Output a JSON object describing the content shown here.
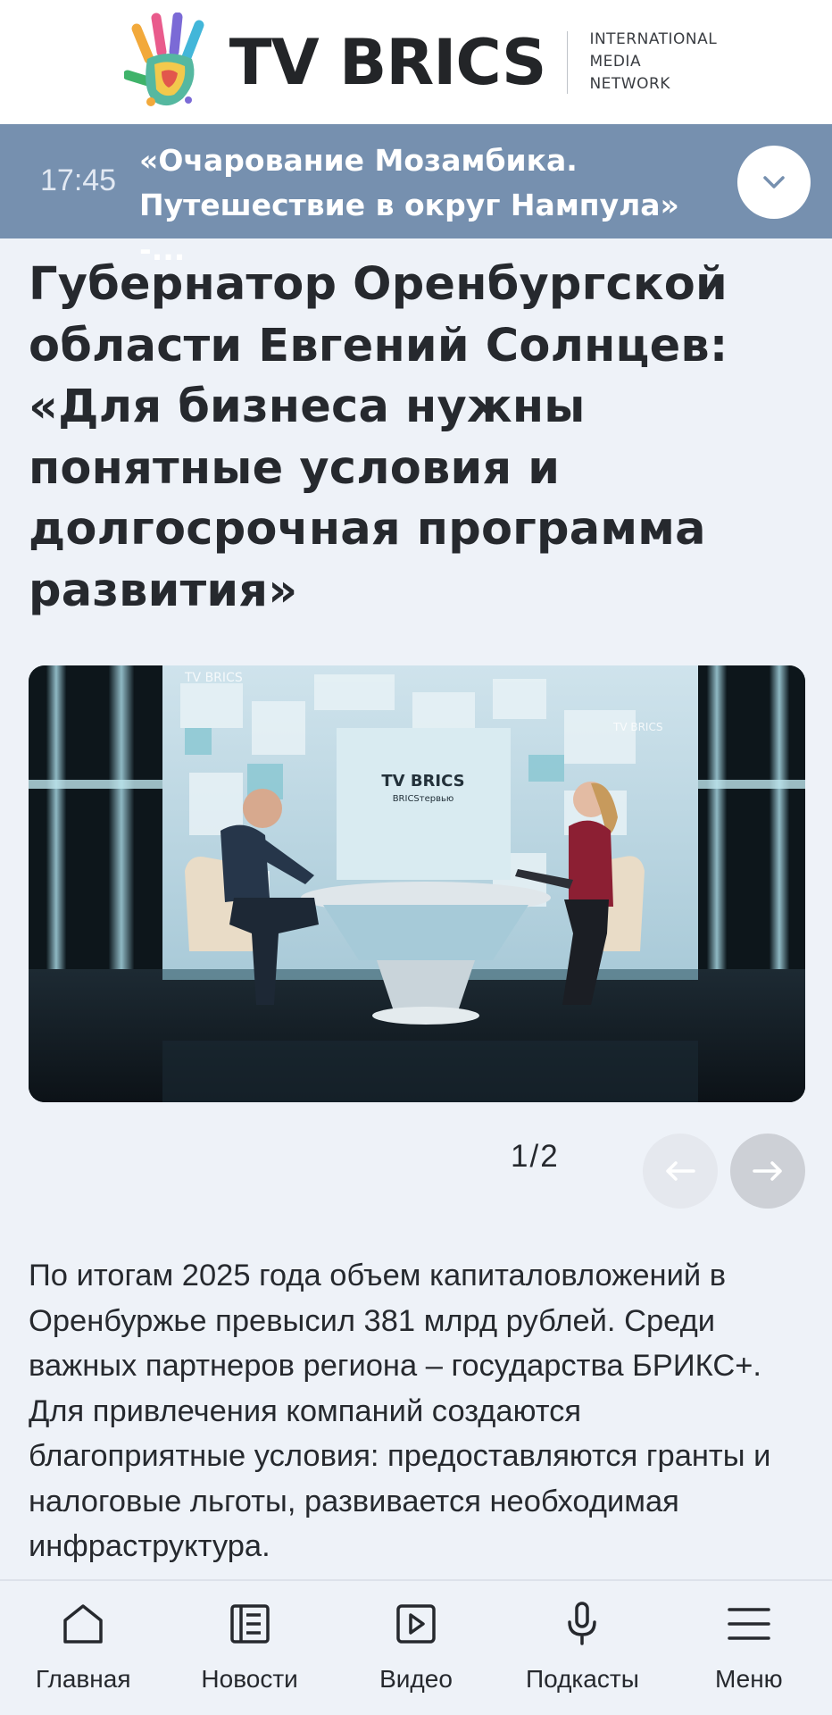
{
  "header": {
    "logo_text": "TV BRICS",
    "logo_sub_lines": [
      "INTERNATIONAL",
      "MEDIA",
      "NETWORK"
    ]
  },
  "live": {
    "time": "17:45",
    "title": "«Очарование Мозамбика. Путешествие в округ Нампула» -...",
    "toggle_icon": "chevron-down-icon"
  },
  "article": {
    "headline": "Губернатор Оренбургской области Евгений Солнцев: «Для бизнеса нужны понятные условия и долгосрочная программа развития»",
    "image": {
      "studio_logo": "TV BRICS",
      "studio_sub": "BRICSтервью",
      "wall_logo_left": "TV BRICS",
      "wall_logo_right": "TV BRICS"
    },
    "pager": {
      "current": "1",
      "separator": "/",
      "total": "2",
      "prev_icon": "arrow-left-icon",
      "next_icon": "arrow-right-icon"
    },
    "body": "По итогам 2025 года объем капиталовложений в Оренбуржье превысил 381 млрд рублей. Среди важных партнеров региона – государства БРИКС+. Для привлечения компаний создаются благоприятные условия: предоставляются гранты и налоговые льготы, развивается необходимая инфраструктура."
  },
  "nav": {
    "items": [
      {
        "label": "Главная",
        "icon": "home-icon"
      },
      {
        "label": "Новости",
        "icon": "news-icon"
      },
      {
        "label": "Видео",
        "icon": "video-icon"
      },
      {
        "label": "Подкасты",
        "icon": "microphone-icon"
      },
      {
        "label": "Меню",
        "icon": "menu-icon"
      }
    ]
  },
  "colors": {
    "live_bar": "#7690af",
    "page_bg": "#eef2f8",
    "text": "#26292e"
  }
}
